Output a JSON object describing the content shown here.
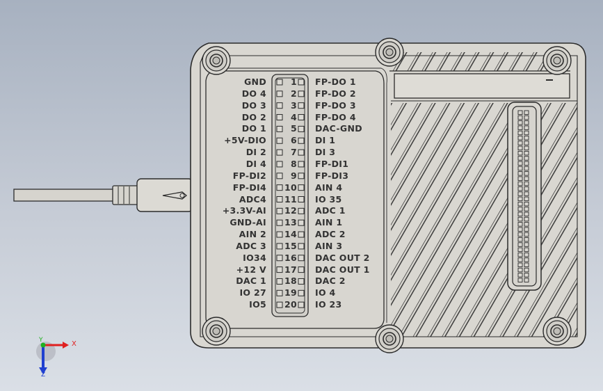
{
  "viewport": {
    "background_top": "#a7b1c0",
    "background_bottom": "#dadfe6",
    "model_color": "#d9d7d1",
    "edge_color": "#2b2b2b"
  },
  "triad": {
    "x_label": "X",
    "y_label": "Y",
    "z_label": "Z",
    "x_color": "#e02020",
    "y_color": "#20b020",
    "z_color": "#2040d0"
  },
  "pins": [
    {
      "num": "1",
      "left": "GND",
      "right": "FP-DO 1"
    },
    {
      "num": "2",
      "left": "DO 4",
      "right": "FP-DO 2"
    },
    {
      "num": "3",
      "left": "DO 3",
      "right": "FP-DO 3"
    },
    {
      "num": "4",
      "left": "DO 2",
      "right": "FP-DO 4"
    },
    {
      "num": "5",
      "left": "DO 1",
      "right": "DAC-GND"
    },
    {
      "num": "6",
      "left": "+5V-DIO",
      "right": "DI 1"
    },
    {
      "num": "7",
      "left": "DI 2",
      "right": "DI 3"
    },
    {
      "num": "8",
      "left": "DI 4",
      "right": "FP-DI1"
    },
    {
      "num": "9",
      "left": "FP-DI2",
      "right": "FP-DI3"
    },
    {
      "num": "10",
      "left": "FP-DI4",
      "right": "AIN 4"
    },
    {
      "num": "11",
      "left": "ADC4",
      "right": "IO 35"
    },
    {
      "num": "12",
      "left": "+3.3V-AI",
      "right": "ADC 1"
    },
    {
      "num": "13",
      "left": "GND-AI",
      "right": "AIN 1"
    },
    {
      "num": "14",
      "left": "AIN 2",
      "right": "ADC 2"
    },
    {
      "num": "15",
      "left": "ADC 3",
      "right": "AIN 3"
    },
    {
      "num": "16",
      "left": "IO34",
      "right": "DAC OUT 2"
    },
    {
      "num": "17",
      "left": "+12 V",
      "right": "DAC OUT 1"
    },
    {
      "num": "18",
      "left": "DAC 1",
      "right": "DAC 2"
    },
    {
      "num": "19",
      "left": "IO 27",
      "right": "IO 4"
    },
    {
      "num": "20",
      "left": "IO5",
      "right": "IO 23"
    }
  ]
}
